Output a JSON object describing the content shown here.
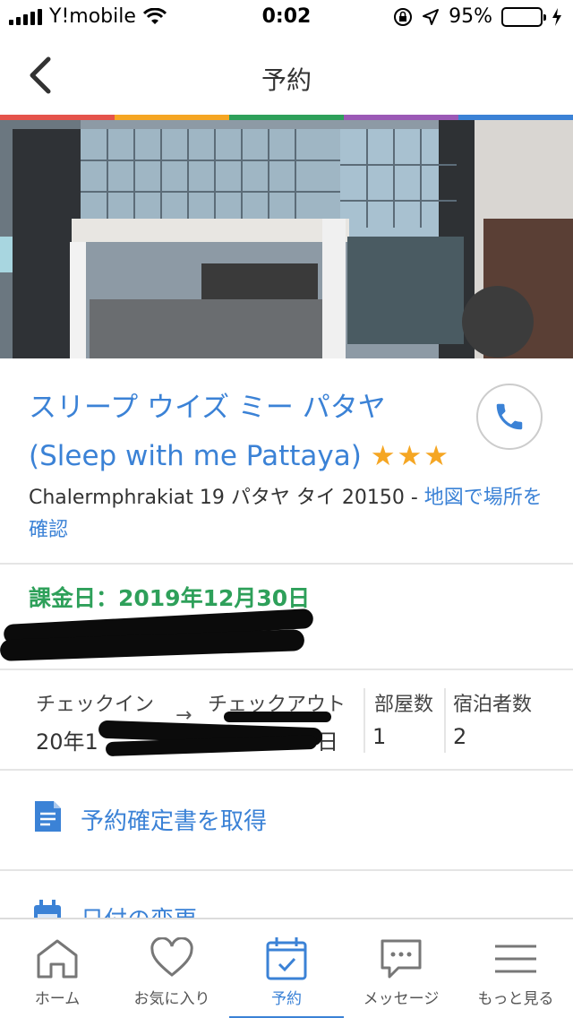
{
  "status_bar": {
    "carrier": "Y!mobile",
    "time": "0:02",
    "battery": "95%",
    "battery_level": 0.95
  },
  "nav": {
    "title": "予約",
    "back_icon": "chevron-left-icon"
  },
  "brand_strip_colors": [
    "#e5534b",
    "#f5a623",
    "#2ea05a",
    "#9b59b6",
    "#3b82d6"
  ],
  "hotel": {
    "name_ja": "スリープ ウイズ ミー パタヤ",
    "name_en": "(Sleep with me Pattaya)",
    "stars": "★★★",
    "star_count": 3,
    "address": "Chalermphrakiat 19 パタヤ タイ 20150 - ",
    "map_link": "地図で場所を確認",
    "call_icon": "phone-icon"
  },
  "billing": {
    "label": "課金日：2019年12月30日"
  },
  "booking": {
    "checkin_label": "チェックイン",
    "checkout_label": "チェックアウト",
    "arrow": "→",
    "checkin_value": "20年1",
    "checkout_value": "日",
    "rooms_label": "部屋数",
    "rooms_value": "1",
    "guests_label": "宿泊者数",
    "guests_value": "2"
  },
  "actions": [
    {
      "label": "予約確定書を取得",
      "icon": "document-icon"
    },
    {
      "label": "日付の変更",
      "icon": "calendar-icon"
    }
  ],
  "tabs": [
    {
      "label": "ホーム",
      "icon": "home-icon"
    },
    {
      "label": "お気に入り",
      "icon": "heart-icon"
    },
    {
      "label": "予約",
      "icon": "calendar-check-icon",
      "active": true
    },
    {
      "label": "メッセージ",
      "icon": "message-icon"
    },
    {
      "label": "もっと見る",
      "icon": "menu-icon"
    }
  ],
  "colors": {
    "accent": "#3b82d6",
    "billing": "#2ea05a",
    "stars": "#f5a623"
  }
}
